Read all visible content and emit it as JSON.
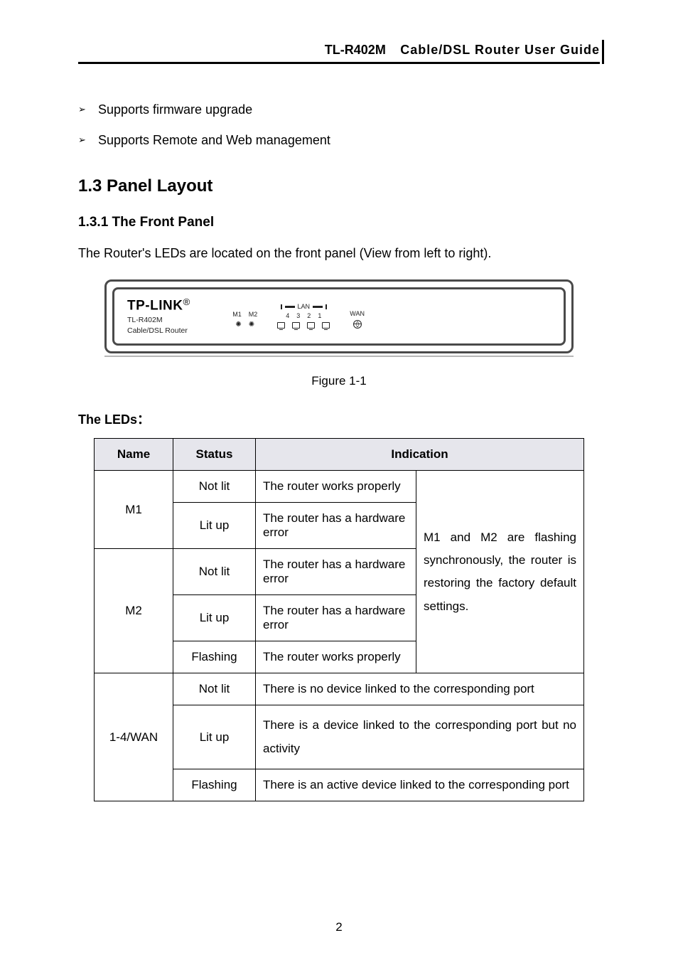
{
  "header": {
    "model": "TL-R402M",
    "title": "Cable/DSL  Router  User  Guide"
  },
  "bullets": [
    "Supports firmware upgrade",
    "Supports Remote and Web management"
  ],
  "section": {
    "num_title": "1.3   Panel Layout"
  },
  "subsection": {
    "num_title": "1.3.1  The Front Panel"
  },
  "intro": "The Router's LEDs are located on the front panel (View from left to right).",
  "figure": {
    "brand": "TP-LINK",
    "brand_reg": "®",
    "model_line": "TL-R402M",
    "subtitle": "Cable/DSL Router",
    "m1": "M1",
    "m2": "M2",
    "lan_label": "LAN",
    "lan_nums": [
      "4",
      "3",
      "2",
      "1"
    ],
    "wan": "WAN",
    "caption": "Figure 1-1"
  },
  "leds_heading": "The LEDs：",
  "table": {
    "headers": {
      "name": "Name",
      "status": "Status",
      "indication": "Indication"
    },
    "m1": {
      "name": "M1",
      "r1_status": "Not lit",
      "r1_ind": "The router works properly",
      "r2_status": "Lit up",
      "r2_ind": "The router has a hardware error"
    },
    "m2": {
      "name": "M2",
      "r1_status": "Not lit",
      "r1_ind": "The router has a hardware error",
      "r2_status": "Lit up",
      "r2_ind": "The router has a hardware error",
      "r3_status": "Flashing",
      "r3_ind": "The router works properly"
    },
    "shared_note": "M1 and M2 are flashing synchronously, the router is restoring the factory default settings.",
    "wan": {
      "name": "1-4/WAN",
      "r1_status": "Not lit",
      "r1_ind": "There is no device linked to the corresponding port",
      "r2_status": "Lit up",
      "r2_ind": "There is a device linked to the corresponding port but no activity",
      "r3_status": "Flashing",
      "r3_ind": "There is an active device linked to the corresponding port"
    }
  },
  "page_number": "2"
}
